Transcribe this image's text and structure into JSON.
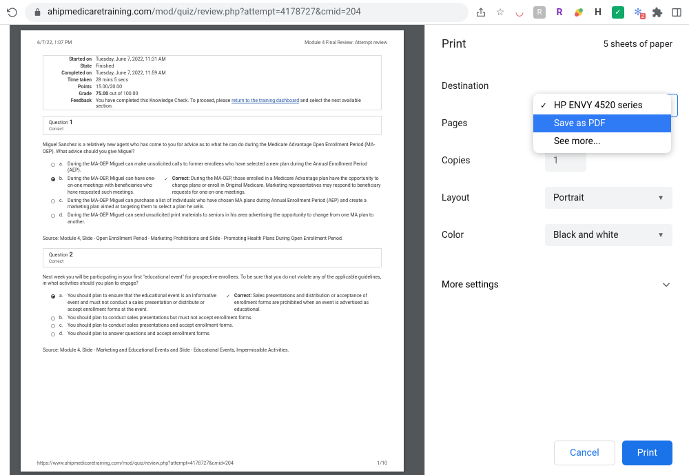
{
  "url": {
    "host": "ahipmedicaretraining.com",
    "path": "/mod/quiz/review.php?attempt=4178727&cmid=204"
  },
  "page_preview": {
    "timestamp": "6/7/22, 1:07 PM",
    "title": "Module 4 Final Review: Attempt review",
    "info": {
      "started_label": "Started on",
      "started": "Tuesday, June 7, 2022, 11:31 AM",
      "state_label": "State",
      "state": "Finished",
      "completed_label": "Completed on",
      "completed": "Tuesday, June 7, 2022, 11:59 AM",
      "time_label": "Time taken",
      "time": "28 mins 5 secs",
      "points_label": "Points",
      "points": "15.00/20.00",
      "grade_label": "Grade",
      "grade_bold": "75.00",
      "grade_rest": " out of 100.00",
      "feedback_label": "Feedback",
      "feedback_pre": "You have completed this Knowledge Check. To proceed, please ",
      "feedback_link": "return to the training dashboard",
      "feedback_post": " and select the next available section."
    },
    "q1": {
      "label": "Question ",
      "num": "1",
      "status": "Correct",
      "prompt": "Miguel Sanchez is a relatively new agent who has come to you for advice as to what he can do during the Medicare Advantage Open Enrollment Period (MA-OEP). What advice should you give Miguel?",
      "a_letter": "a.",
      "a": "During the MA-OEP Miguel can make unsolicited calls to former enrollees who have selected a new plan during the Annual Enrollment Period (AEP).",
      "b_letter": "b.",
      "b": "During the MA-OEP, Miguel can have one-on-one meetings with beneficiaries who have requested such meetings.",
      "correct_label": "Correct:",
      "correct": " During the MA-OEP, those enrolled in a Medicare Advantage plan have the opportunity to change plans or enroll in Original Medicare. Marketing representatives may respond to beneficiary requests for one-on-one meetings.",
      "c_letter": "c.",
      "c": "During the MA-OEP Miguel can purchase a list of individuals who have chosen MA plans during Annual Enrollment Period (AEP) and create a marketing plan aimed at targeting them to select a plan he sells.",
      "d_letter": "d.",
      "d": "During the MA-OEP Miguel can send unsolicited print materials to seniors in his area advertising the opportunity to change from one MA plan to another.",
      "source": "Source: Module 4, Slide - Open Enrollment Period - Marketing Prohibitions and Slide - Promoting Health Plans During Open Enrollment Period."
    },
    "q2": {
      "label": "Question ",
      "num": "2",
      "status": "Correct",
      "prompt": "Next week you will be participating in your first \"educational event\" for prospective enrollees. To be sure that you do not violate any of the applicable guidelines, in what activities should you plan to engage?",
      "a_letter": "a.",
      "a": "You should plan to ensure that the educational event is an informative event and must not conduct a sales presentation or distribute or accept enrollment forms at the event.",
      "correct_label": "Correct:",
      "correct": " Sales presentations and distribution or acceptance of enrollment forms are prohibited when an event is advertised as educational.",
      "b_letter": "b.",
      "b": "You should plan to conduct sales presentations but must not accept enrollment forms.",
      "c_letter": "c.",
      "c": "You should plan to conduct sales presentations and accept enrollment forms.",
      "d_letter": "d.",
      "d": "You should plan to answer questions and accept enrollment forms.",
      "source": "Source: Module 4, Slide - Marketing and Educational Events and Slide - Educational Events, Impermissible Activities."
    },
    "footer_url": "https://www.ahipmedicaretraining.com/mod/quiz/review.php?attempt=4178727&cmid=204",
    "page_num": "1/10"
  },
  "print": {
    "title": "Print",
    "sheets": "5 sheets of paper",
    "labels": {
      "destination": "Destination",
      "pages": "Pages",
      "copies": "Copies",
      "layout": "Layout",
      "color": "Color",
      "more": "More settings"
    },
    "values": {
      "copies": "1",
      "layout": "Portrait",
      "color": "Black and white"
    },
    "dropdown": {
      "opt1": "HP ENVY 4520 series",
      "opt2": "Save as PDF",
      "opt3": "See more..."
    },
    "buttons": {
      "cancel": "Cancel",
      "print": "Print"
    }
  }
}
